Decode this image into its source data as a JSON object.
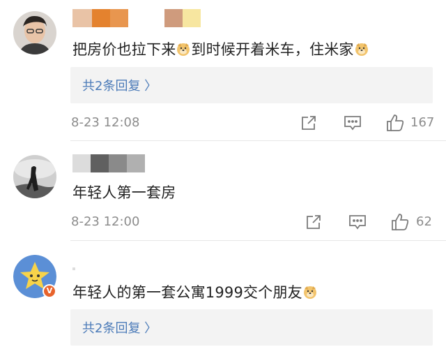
{
  "comments": [
    {
      "text": "把房价也拉下来",
      "text_mid": "到时候开着米车，住米家",
      "reply_link": "共2条回复 〉",
      "time": "8-23 12:08",
      "likes": "167"
    },
    {
      "text": "年轻人第一套房",
      "time": "8-23 12:00",
      "likes": "62"
    },
    {
      "text": "年轻人的第一套公寓1999交个朋友",
      "reply_link": "共2条回复 〉"
    }
  ],
  "icons": {
    "share": "share-icon",
    "comment": "comment-icon",
    "like": "thumbs-up-icon",
    "emoji": "doge-emoji-icon",
    "verified": "verified-badge-icon"
  },
  "colors": {
    "link": "#4a7ab8",
    "muted": "#8c8c8c",
    "reply_bg": "#f3f3f3",
    "verified": "#e8632c"
  }
}
